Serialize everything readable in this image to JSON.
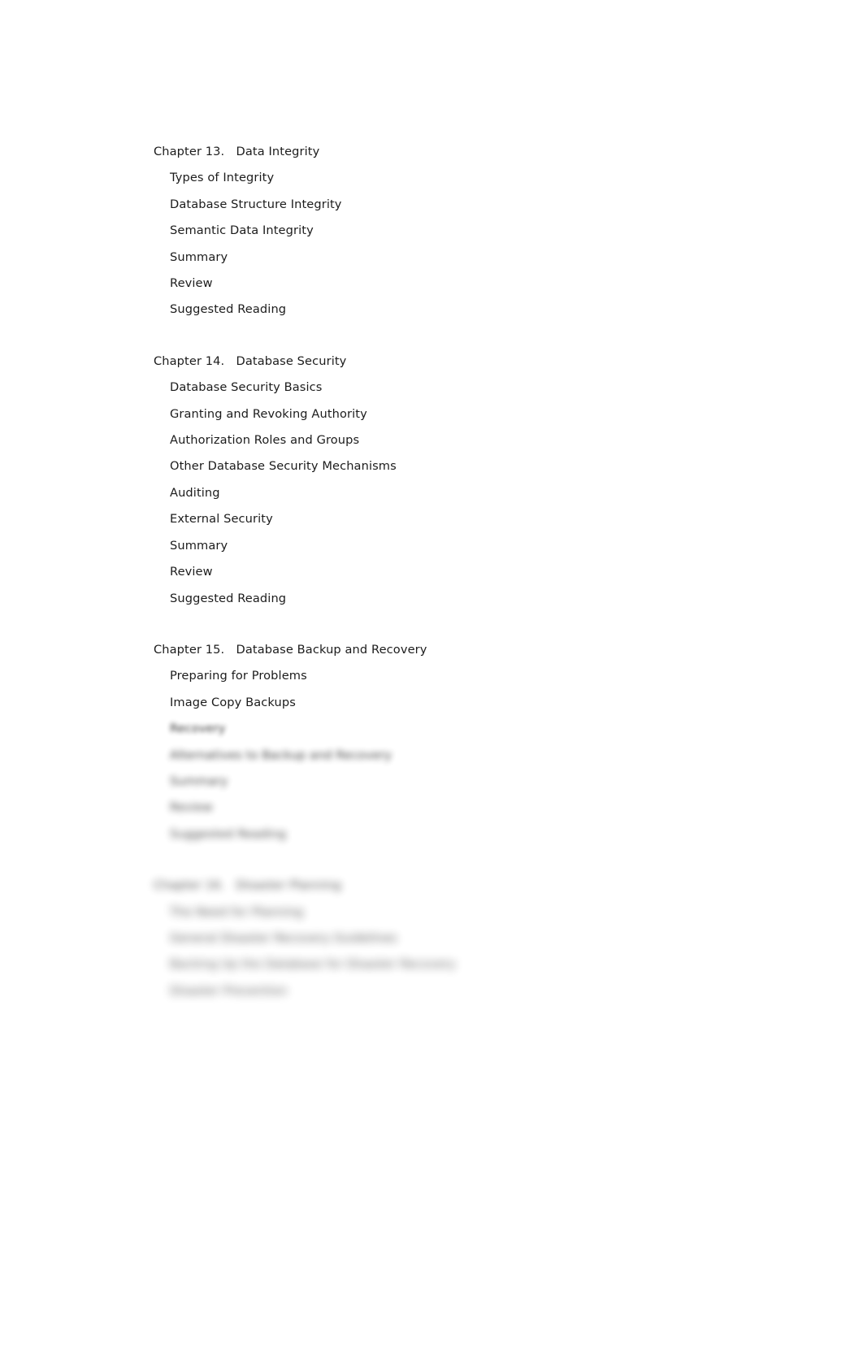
{
  "document": {
    "type": "book-table-of-contents",
    "background_color": "#ffffff",
    "text_color": "#1c1c1c"
  },
  "toc": {
    "chapters": [
      {
        "heading": "Chapter 13.   Data Integrity",
        "number": "Chapter 13.",
        "name": "Data Integrity",
        "blur": 0,
        "entries": [
          {
            "label": "Types of Integrity",
            "blur": 0
          },
          {
            "label": "Database Structure Integrity",
            "blur": 0
          },
          {
            "label": "Semantic Data Integrity",
            "blur": 0
          },
          {
            "label": "Summary",
            "blur": 0
          },
          {
            "label": "Review",
            "blur": 0
          },
          {
            "label": "Suggested Reading",
            "blur": 0
          }
        ]
      },
      {
        "heading": "Chapter 14.   Database Security",
        "number": "Chapter 14.",
        "name": "Database Security",
        "blur": 0,
        "entries": [
          {
            "label": "Database Security Basics",
            "blur": 0
          },
          {
            "label": "Granting and Revoking Authority",
            "blur": 0
          },
          {
            "label": "Authorization Roles and Groups",
            "blur": 0
          },
          {
            "label": "Other Database Security Mechanisms",
            "blur": 0
          },
          {
            "label": "Auditing",
            "blur": 0
          },
          {
            "label": "External Security",
            "blur": 0
          },
          {
            "label": "Summary",
            "blur": 0
          },
          {
            "label": "Review",
            "blur": 0
          },
          {
            "label": "Suggested Reading",
            "blur": 0
          }
        ]
      },
      {
        "heading": "Chapter 15.   Database Backup and Recovery",
        "number": "Chapter 15.",
        "name": "Database Backup and Recovery",
        "blur": 0,
        "entries": [
          {
            "label": "Preparing for Problems",
            "blur": 0
          },
          {
            "label": "Image Copy Backups",
            "blur": 0
          },
          {
            "label": "Recovery",
            "blur": 2
          },
          {
            "label": "Alternatives to Backup and Recovery",
            "blur": 4
          },
          {
            "label": "Summary",
            "blur": 5
          },
          {
            "label": "Review",
            "blur": 6
          },
          {
            "label": "Suggested Reading",
            "blur": 7
          }
        ]
      },
      {
        "heading": "Chapter 16.   Disaster Planning",
        "number": "Chapter 16.",
        "name": "Disaster Planning",
        "blur": 8,
        "entries": [
          {
            "label": "The Need for Planning",
            "blur": 9
          },
          {
            "label": "General Disaster Recovery Guidelines",
            "blur": 9
          },
          {
            "label": "Backing Up the Database for Disaster Recovery",
            "blur": 10
          },
          {
            "label": "Disaster Prevention",
            "blur": 10
          }
        ]
      }
    ]
  }
}
